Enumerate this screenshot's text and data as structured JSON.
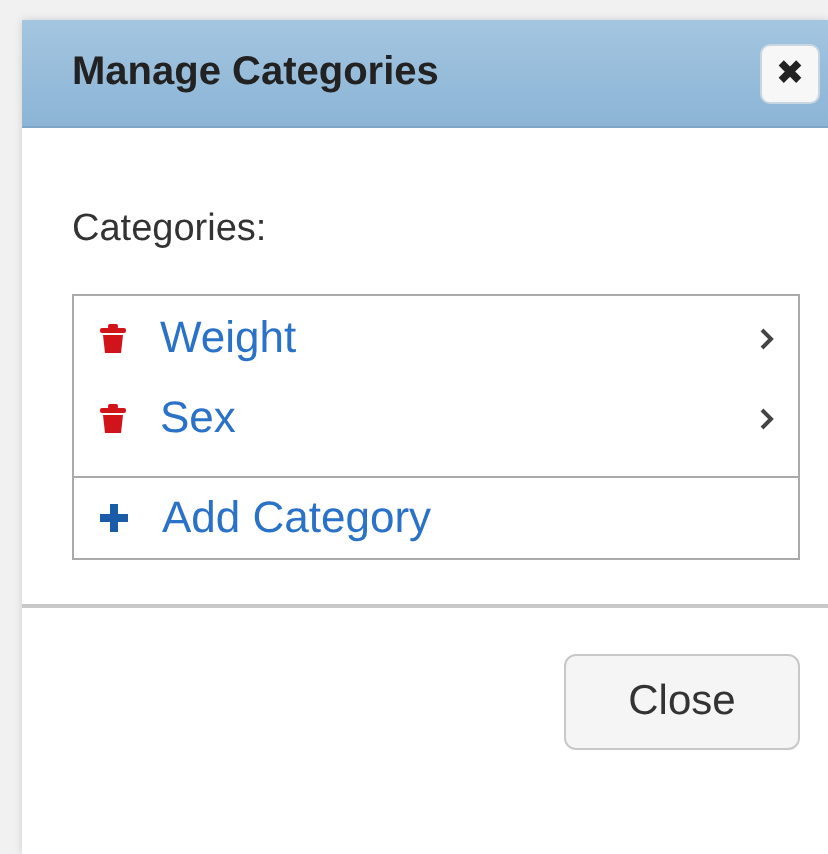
{
  "dialog": {
    "title": "Manage Categories",
    "close_icon": "✖"
  },
  "label": "Categories:",
  "categories": [
    {
      "name": "Weight"
    },
    {
      "name": "Sex"
    }
  ],
  "add_label": "Add Category",
  "buttons": [
    "Close"
  ]
}
